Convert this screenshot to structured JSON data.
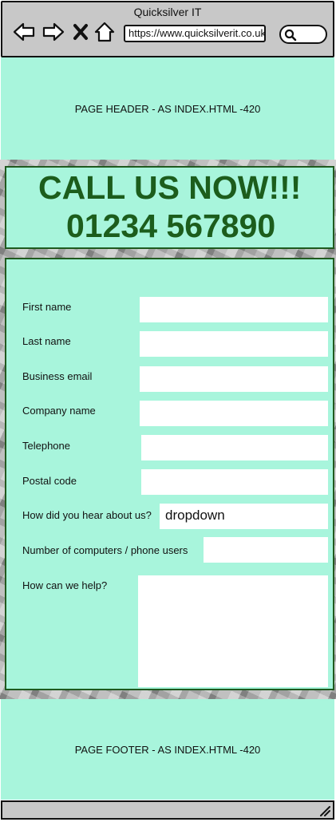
{
  "browser": {
    "title": "Quicksilver IT",
    "url": "https://www.quicksilverit.co.uk",
    "icons": [
      "back-arrow-icon",
      "forward-arrow-icon",
      "close-icon",
      "home-icon",
      "search-icon"
    ]
  },
  "header": {
    "text": "PAGE HEADER - AS INDEX.HTML -420"
  },
  "banner": {
    "line1": "CALL US NOW!!!",
    "line2": "01234 567890"
  },
  "form": {
    "first_name_label": "First name",
    "last_name_label": "Last name",
    "business_email_label": "Business email",
    "company_name_label": "Company name",
    "telephone_label": "Telephone",
    "postal_code_label": "Postal code",
    "hear_about_label": "How did you hear about us?",
    "hear_about_value": "dropdown",
    "computers_label": "Number of computers / phone users",
    "help_label": "How can we help?"
  },
  "footer": {
    "text": "PAGE FOOTER - AS INDEX.HTML -420"
  },
  "colors": {
    "panel_bg": "#a8f5dc",
    "banner_text": "#1c5d1c",
    "border": "#1f5a1f",
    "chrome": "#c8c8c8"
  }
}
